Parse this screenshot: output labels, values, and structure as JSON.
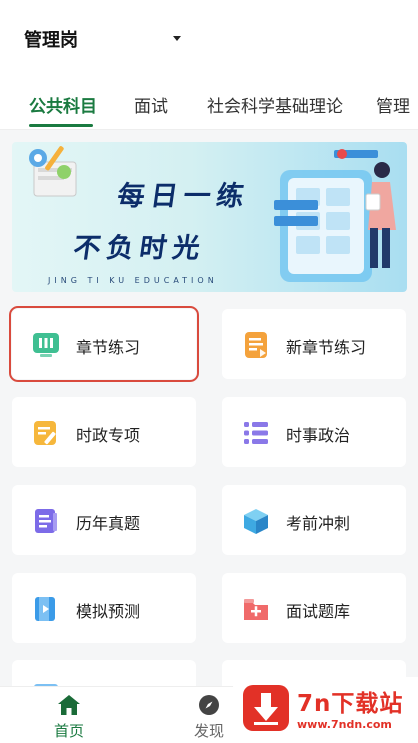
{
  "header": {
    "selector_label": "管理岗"
  },
  "tabs": [
    {
      "label": "公共科目",
      "active": true
    },
    {
      "label": "面试",
      "active": false
    },
    {
      "label": "社会科学基础理论",
      "active": false
    },
    {
      "label": "管理",
      "active": false
    }
  ],
  "banner": {
    "line1": "每日一练",
    "line2": "不负时光",
    "subtitle": "JING TI KU EDUCATION"
  },
  "grid": [
    {
      "label": "章节练习",
      "icon": "chapter-practice-icon",
      "color": "#3fbf92",
      "selected": true
    },
    {
      "label": "新章节练习",
      "icon": "new-chapter-icon",
      "color": "#f4a23c",
      "selected": false
    },
    {
      "label": "时政专项",
      "icon": "current-affairs-icon",
      "color": "#f6b73c",
      "selected": false
    },
    {
      "label": "时事政治",
      "icon": "current-politics-icon",
      "color": "#8a78e8",
      "selected": false
    },
    {
      "label": "历年真题",
      "icon": "past-exams-icon",
      "color": "#7c6be8",
      "selected": false
    },
    {
      "label": "考前冲刺",
      "icon": "sprint-cube-icon",
      "color": "#3ea9e2",
      "selected": false
    },
    {
      "label": "模拟预测",
      "icon": "mock-exam-icon",
      "color": "#3b9be8",
      "selected": false
    },
    {
      "label": "面试题库",
      "icon": "interview-bank-icon",
      "color": "#f06a6a",
      "selected": false
    }
  ],
  "bottom_nav": [
    {
      "label": "首页",
      "icon": "home-icon",
      "active": true
    },
    {
      "label": "发现",
      "icon": "compass-icon",
      "active": false
    }
  ],
  "watermark": {
    "title": "7n下载站",
    "url": "www.7ndn.com"
  },
  "colors": {
    "accent": "#1a7a40",
    "highlight": "#d94a3d",
    "banner_text": "#0c2d6a",
    "watermark": "#e23127"
  }
}
